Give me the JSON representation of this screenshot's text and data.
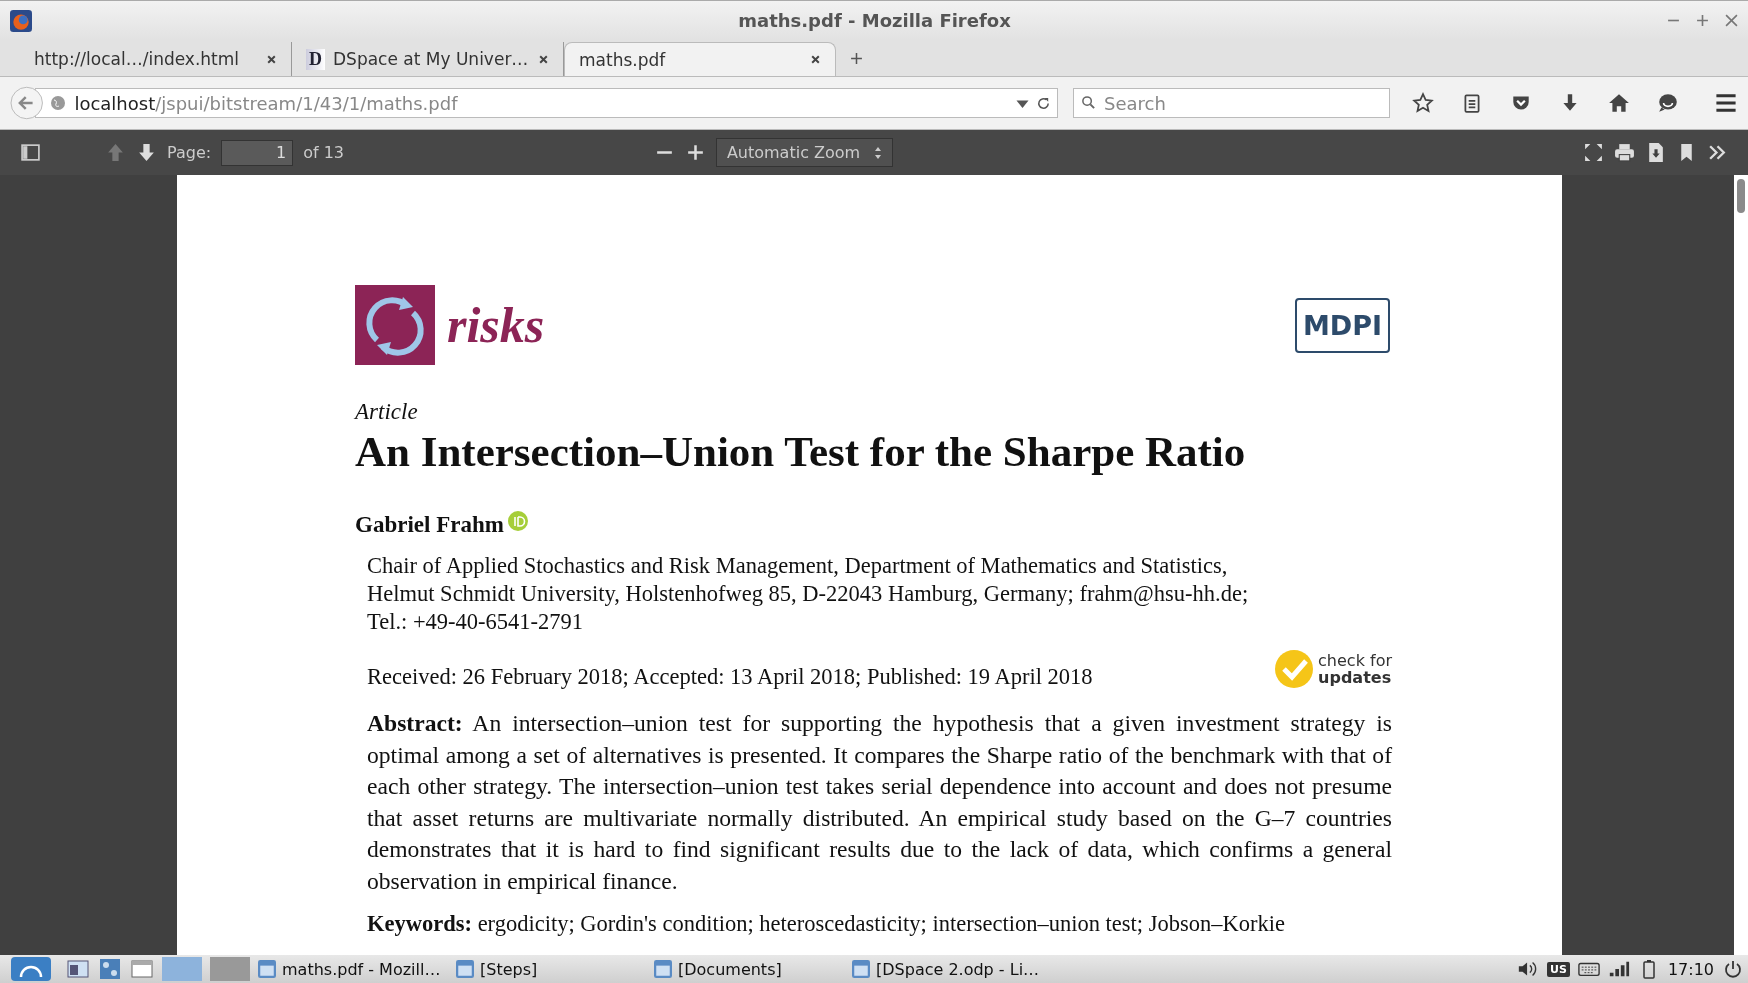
{
  "window": {
    "title": "maths.pdf - Mozilla Firefox"
  },
  "tabs": [
    {
      "label": "http://local…/index.html",
      "selected": false
    },
    {
      "label": "DSpace at My Univer…",
      "selected": false,
      "favicon": "D"
    },
    {
      "label": "maths.pdf",
      "selected": true
    }
  ],
  "url": {
    "host": "localhost",
    "path": "/jspui/bitstream/1/43/1/maths.pdf"
  },
  "search": {
    "placeholder": "Search"
  },
  "pdf_toolbar": {
    "page_label": "Page:",
    "page_value": "1",
    "page_count": "of 13",
    "zoom": "Automatic Zoom"
  },
  "document": {
    "journal": "risks",
    "publisher": "MDPI",
    "article_type": "Article",
    "title": "An Intersection–Union Test for the Sharpe Ratio",
    "author": "Gabriel Frahm",
    "affiliation": [
      "Chair of Applied Stochastics and Risk Management, Department of Mathematics and Statistics,",
      "Helmut Schmidt University, Holstenhofweg 85, D-22043 Hamburg, Germany; frahm@hsu-hh.de;",
      "Tel.: +49-40-6541-2791"
    ],
    "dates": "Received: 26 February 2018; Accepted: 13 April 2018; Published: 19 April 2018",
    "badge": {
      "line1": "check for",
      "line2": "updates"
    },
    "abstract": "**Abstract:** An intersection–union test for supporting the hypothesis that a given investment strategy is optimal among a set of alternatives is presented. It compares the Sharpe ratio of the benchmark with that of each other strategy. The intersection–union test takes serial dependence into account and does not presume that asset returns are multivariate normally distributed. An empirical study based on the G–7 countries demonstrates that it is hard to find significant results due to the lack of data, which confirms a general observation in empirical finance.",
    "keywords": "**Keywords:** ergodicity; Gordin's condition; heteroscedasticity; intersection–union test; Jobson–Korkie"
  },
  "taskbar": {
    "items": [
      {
        "label": "maths.pdf - Mozill…"
      },
      {
        "label": "[Steps]"
      },
      {
        "label": "[Documents]"
      },
      {
        "label": "[DSpace 2.odp - Li…"
      }
    ],
    "keyboard": "US",
    "clock": "17:10"
  }
}
